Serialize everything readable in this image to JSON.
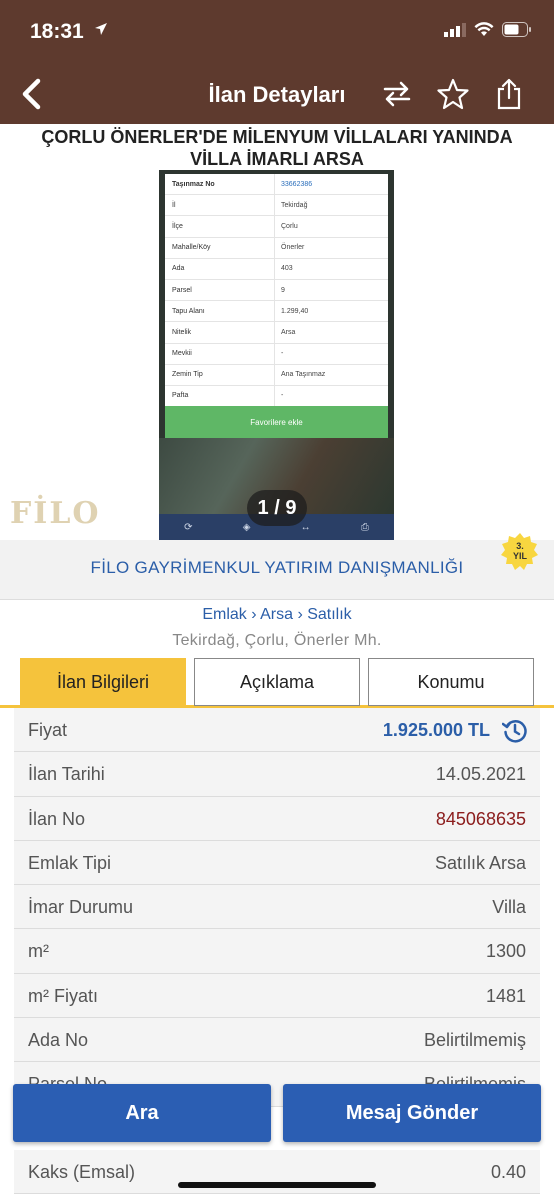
{
  "status": {
    "time": "18:31"
  },
  "nav": {
    "title": "İlan Detayları"
  },
  "listing": {
    "title_line1": "ÇORLU ÖNERLER'DE MİLENYUM VİLLALARI YANINDA",
    "title_line2": "VİLLA İMARLI ARSA"
  },
  "photo": {
    "counter": "1 / 9",
    "watermark": "FİLO",
    "table": [
      {
        "label": "Taşınmaz No",
        "value": "33662386"
      },
      {
        "label": "İl",
        "value": "Tekirdağ"
      },
      {
        "label": "İlçe",
        "value": "Çorlu"
      },
      {
        "label": "Mahalle/Köy",
        "value": "Önerler"
      },
      {
        "label": "Ada",
        "value": "403"
      },
      {
        "label": "Parsel",
        "value": "9"
      },
      {
        "label": "Tapu Alanı",
        "value": "1.299,40"
      },
      {
        "label": "Nitelik",
        "value": "Arsa"
      },
      {
        "label": "Mevkii",
        "value": "-"
      },
      {
        "label": "Zemin Tip",
        "value": "Ana Taşınmaz"
      },
      {
        "label": "Pafta",
        "value": "-"
      }
    ],
    "fav_button": "Favorilere ekle"
  },
  "agency": {
    "name": "FİLO GAYRİMENKUL YATIRIM DANIŞMANLIĞI",
    "year_num": "3.",
    "year_label": "YIL"
  },
  "breadcrumb": {
    "text": "Emlak › Arsa › Satılık"
  },
  "location": "Tekirdağ, Çorlu, Önerler Mh.",
  "tabs": [
    {
      "label": "İlan Bilgileri"
    },
    {
      "label": "Açıklama"
    },
    {
      "label": "Konumu"
    }
  ],
  "details": [
    {
      "label": "Fiyat",
      "value": "1.925.000 TL"
    },
    {
      "label": "İlan Tarihi",
      "value": "14.05.2021"
    },
    {
      "label": "İlan No",
      "value": "845068635"
    },
    {
      "label": "Emlak Tipi",
      "value": "Satılık Arsa"
    },
    {
      "label": "İmar Durumu",
      "value": "Villa"
    },
    {
      "label": "m²",
      "value": "1300"
    },
    {
      "label": "m² Fiyatı",
      "value": "1481"
    },
    {
      "label": "Ada No",
      "value": "Belirtilmemiş"
    },
    {
      "label": "Parsel No",
      "value": "Belirtilmemiş"
    }
  ],
  "extra": {
    "label": "Kaks (Emsal)",
    "value": "0.40"
  },
  "actions": {
    "call": "Ara",
    "message": "Mesaj Gönder"
  },
  "colors": {
    "header": "#5e3a2e",
    "accent": "#f5c33c",
    "primary": "#2b5eb3",
    "price": "#2b5ea8",
    "ad_no": "#8b1c1c"
  }
}
